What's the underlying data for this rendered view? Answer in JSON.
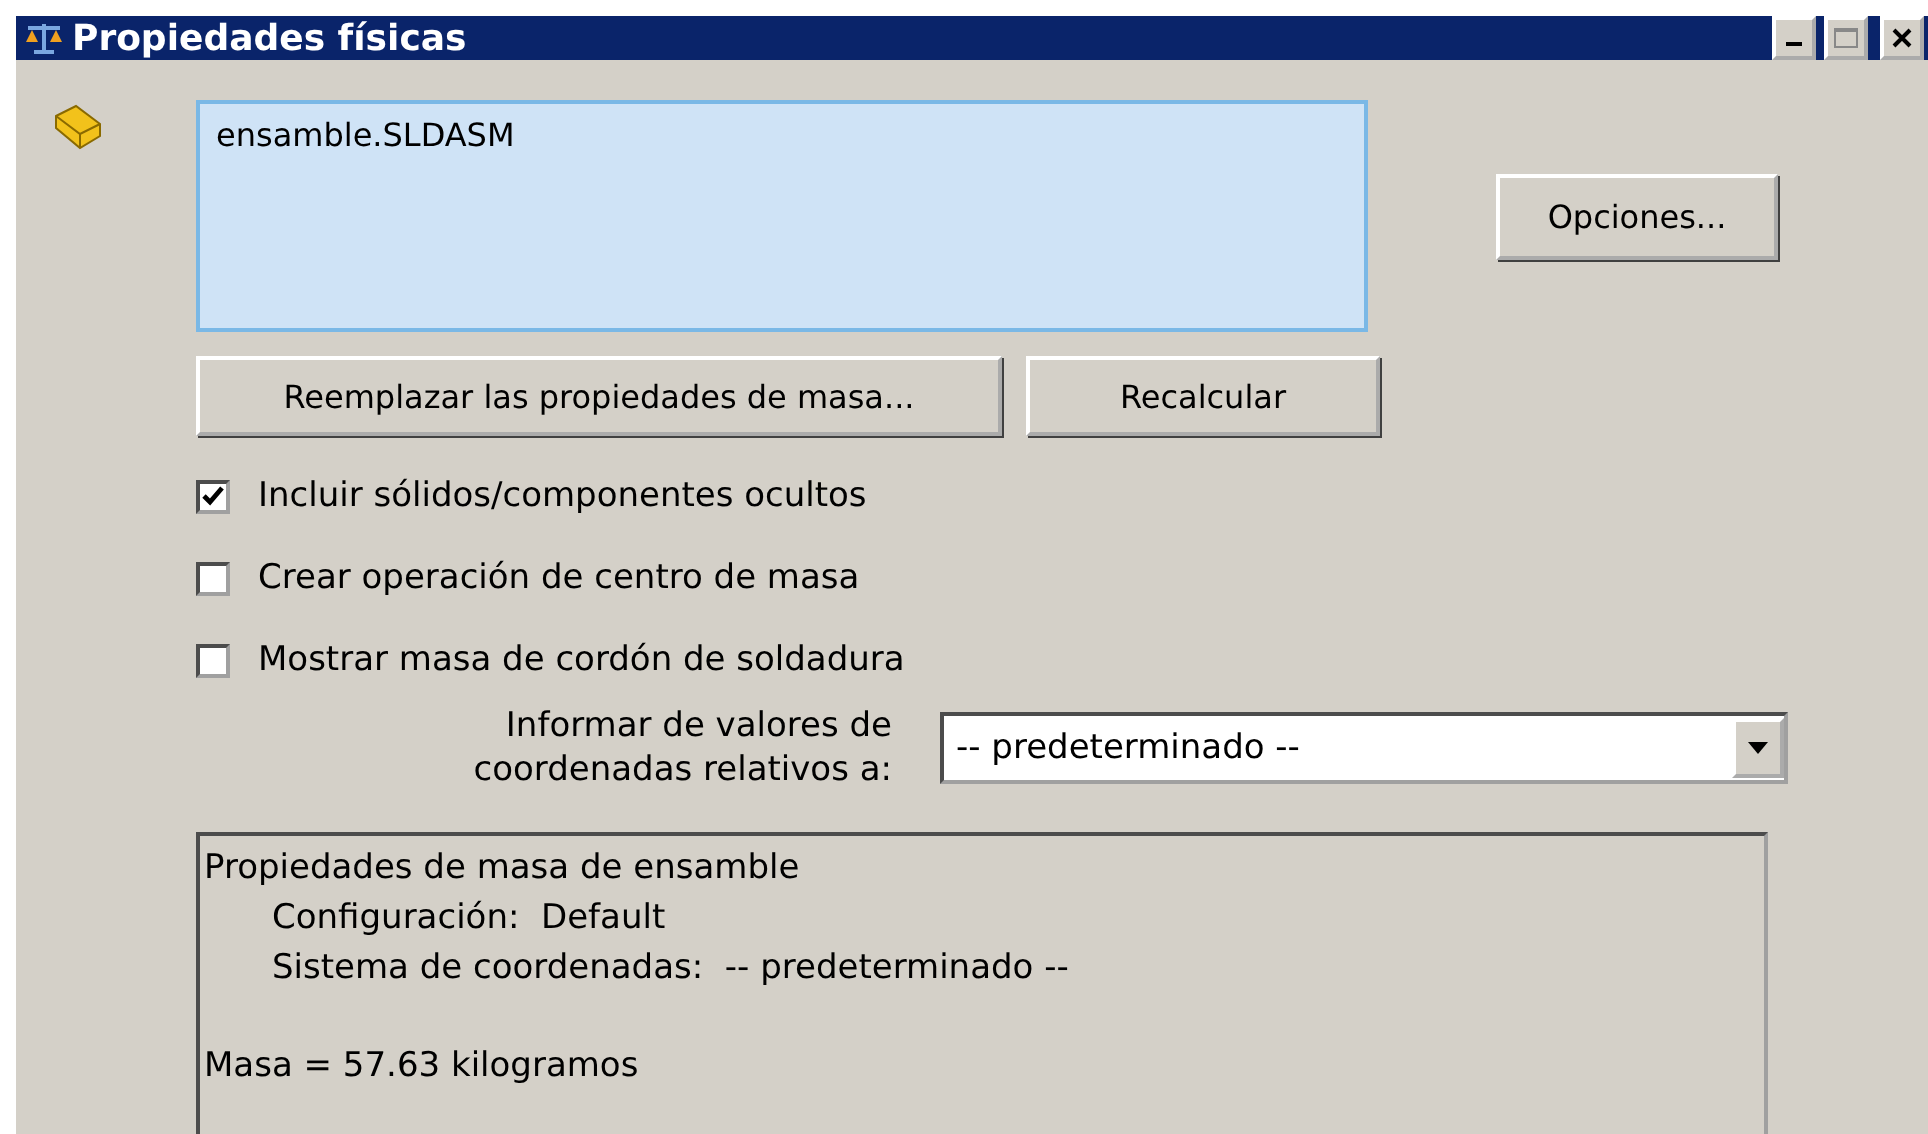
{
  "window": {
    "title": "Propiedades físicas"
  },
  "selection": {
    "items": [
      "ensamble.SLDASM"
    ]
  },
  "buttons": {
    "options": "Opciones...",
    "replace": "Reemplazar las propiedades de masa...",
    "recalculate": "Recalcular"
  },
  "checkboxes": [
    {
      "label": "Incluir sólidos/componentes ocultos",
      "checked": true
    },
    {
      "label": "Crear operación de centro de masa",
      "checked": false
    },
    {
      "label": "Mostrar masa de cordón de soldadura",
      "checked": false
    }
  ],
  "coordinates": {
    "label_lines": [
      "Informar de valores de",
      "coordenadas relativos a:"
    ],
    "value": "-- predeterminado --"
  },
  "results": [
    {
      "text": "Propiedades de masa de ensamble",
      "children": [
        {
          "text": "Configuración:  Default"
        },
        {
          "text": "Sistema de coordenadas:  -- predeterminado --"
        }
      ]
    },
    {
      "text": "Masa = 57.63 kilogramos"
    }
  ]
}
